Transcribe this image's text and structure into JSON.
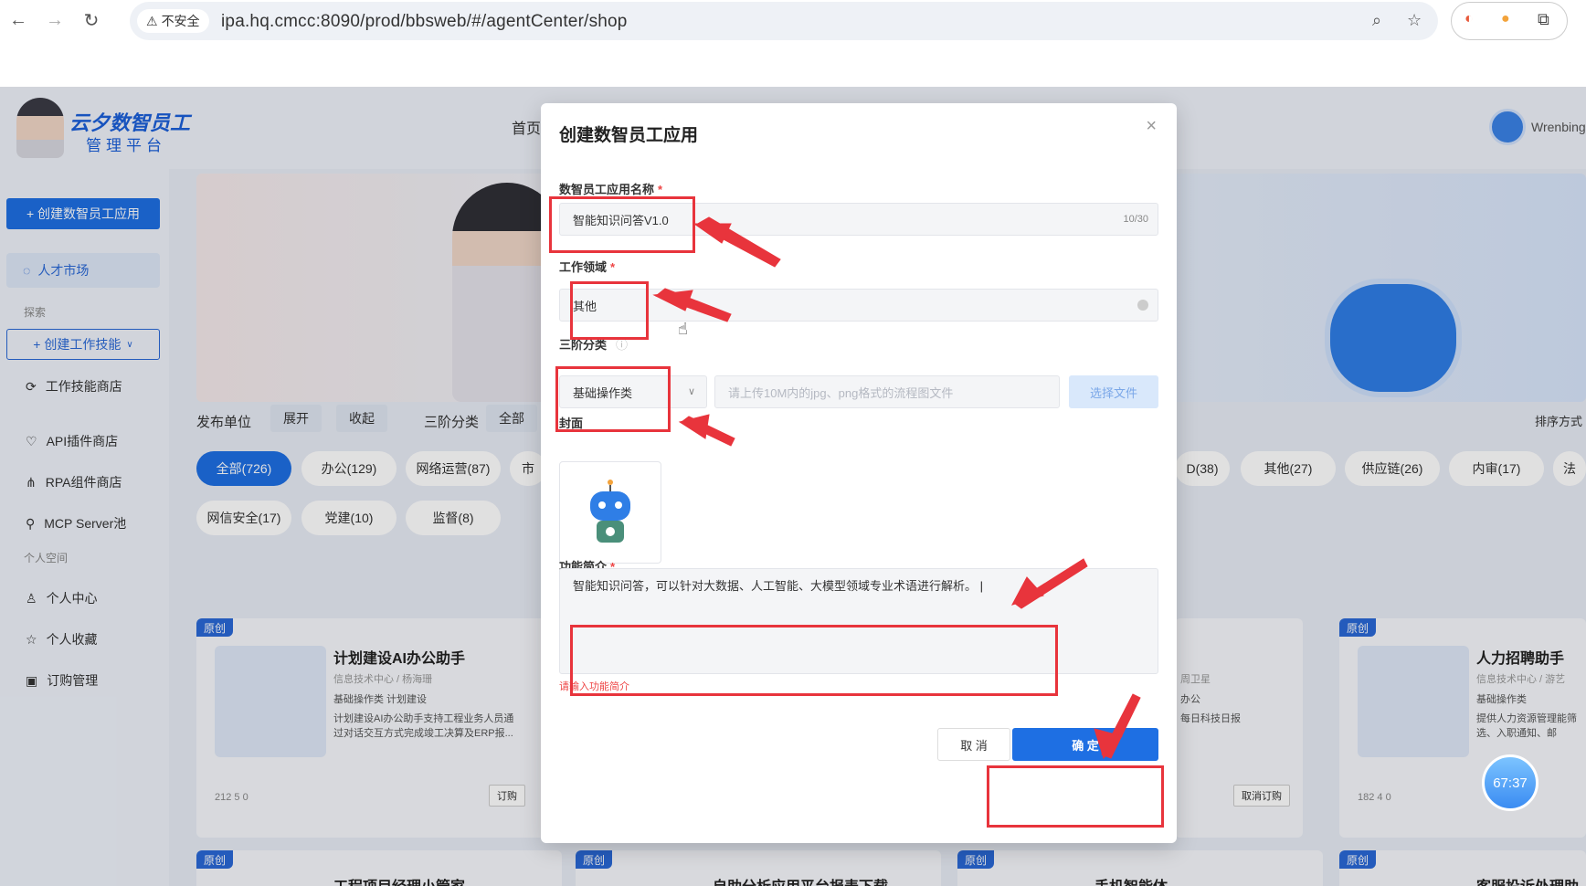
{
  "browser": {
    "security_label": "不安全",
    "url": "ipa.hq.cmcc:8090/prod/bbsweb/#/agentCenter/shop"
  },
  "header": {
    "logo_title": "云夕数智员工",
    "logo_subtitle": "管理平台",
    "nav_home": "首页",
    "user_name": "Wrenbing"
  },
  "sidebar": {
    "create_app": "+ 创建数智员工应用",
    "talent_market": "人才市场",
    "section_explore": "探索",
    "create_skill": "+ 创建工作技能",
    "items": [
      "工作技能商店",
      "API插件商店",
      "RPA组件商店",
      "MCP Server池"
    ],
    "section_personal": "个人空间",
    "personal_items": [
      "个人中心",
      "个人收藏",
      "订购管理"
    ]
  },
  "filters": {
    "publisher_label": "发布单位",
    "expand": "展开",
    "collapse": "收起",
    "third_level_label": "三阶分类",
    "all": "全部",
    "sort_label": "排序方式",
    "pills_row1_left": [
      "全部(726)",
      "办公(129)",
      "网络运营(87)",
      "市"
    ],
    "pills_row1_right": [
      "D(38)",
      "其他(27)",
      "供应链(26)",
      "内审(17)",
      "法"
    ],
    "pills_row2": [
      "网信安全(17)",
      "党建(10)",
      "监督(8)"
    ]
  },
  "cards": [
    {
      "badge": "原创",
      "title": "计划建设AI办公助手",
      "subtitle": "信息技术中心 / 杨海珊",
      "tags": "基础操作类  计划建设",
      "desc": "计划建设AI办公助手支持工程业务人员通过对话交互方式完成竣工决算及ERP报...",
      "stats": "212   5   0",
      "action": "订购"
    },
    {
      "badge": "",
      "title": "",
      "subtitle": "周卫星",
      "tags": "办公",
      "desc": "每日科技日报",
      "stats": "",
      "action": "取消订购"
    },
    {
      "badge": "原创",
      "title": "人力招聘助手",
      "subtitle": "信息技术中心 / 游艺",
      "tags": "基础操作类",
      "desc": "提供人力资源管理能筛选、入职通知、邮",
      "stats": "182   4   0",
      "action": ""
    }
  ],
  "bottom_cards": [
    {
      "badge": "原创",
      "title": "工程项目经理小管家"
    },
    {
      "badge": "原创",
      "title": "自助分析应用平台报表下载"
    },
    {
      "badge": "原创",
      "title": "手机智能体"
    },
    {
      "badge": "原创",
      "title": "客服投诉处理助"
    }
  ],
  "modal": {
    "title": "创建数智员工应用",
    "name_label": "数智员工应用名称",
    "name_value": "智能知识问答V1.0",
    "name_counter": "10/30",
    "domain_label": "工作领域",
    "domain_value": "其他",
    "category_label": "三阶分类",
    "category_value": "基础操作类",
    "upload_placeholder": "请上传10M内的jpg、png格式的流程图文件",
    "choose_file": "选择文件",
    "cover_label": "封面",
    "intro_label": "功能简介",
    "intro_value": "智能知识问答，可以针对大数据、人工智能、大模型领域专业术语进行解析。",
    "intro_error": "请输入功能简介",
    "cancel": "取 消",
    "confirm": "确 定"
  },
  "timer": "67:37",
  "colors": {
    "primary": "#1e6fe3",
    "annotation_red": "#e8343c"
  }
}
